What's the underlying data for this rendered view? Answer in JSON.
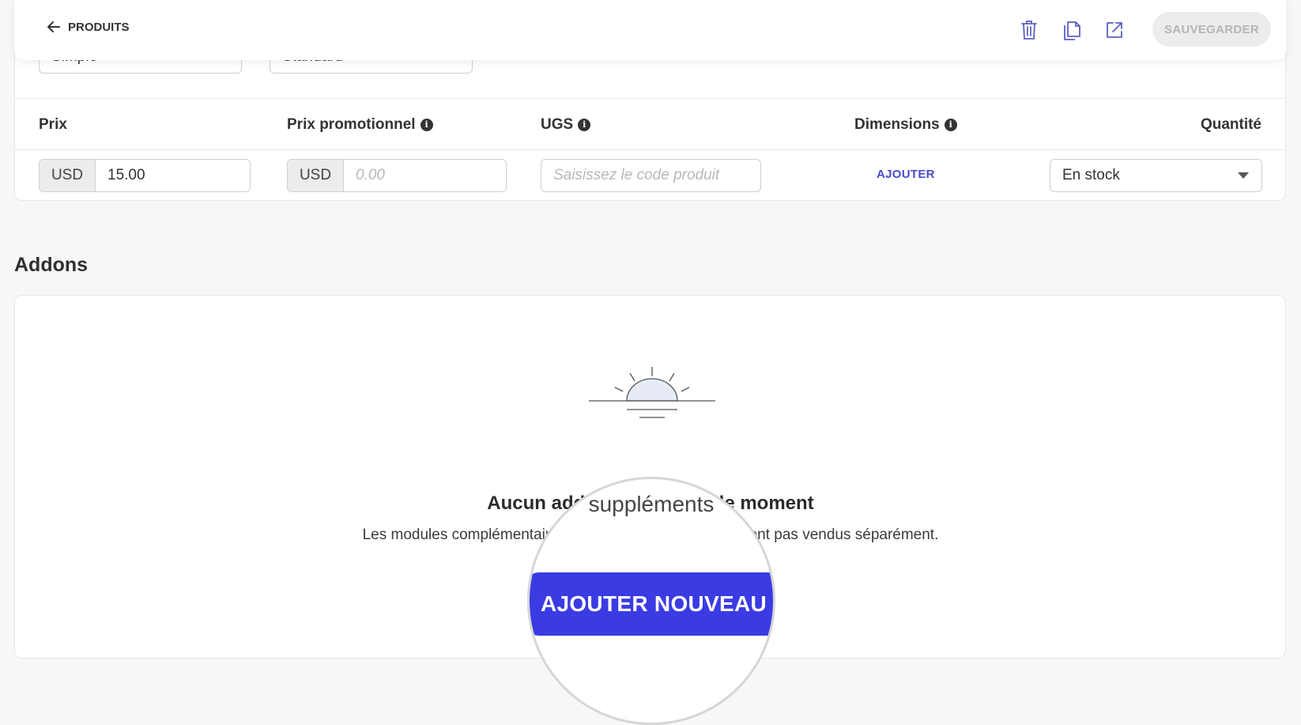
{
  "topbar": {
    "back_label": "PRODUITS",
    "save_label": "SAUVEGARDER",
    "icons": [
      "trash-icon",
      "duplicate-icon",
      "external-link-icon"
    ]
  },
  "variant": {
    "type_select": "Simple",
    "style_select": "Standard",
    "columns": {
      "price": "Prix",
      "promo_price": "Prix promotionnel",
      "sku": "UGS",
      "dimensions": "Dimensions",
      "quantity": "Quantité"
    },
    "price": {
      "currency": "USD",
      "value": "15.00"
    },
    "promo_price": {
      "currency": "USD",
      "placeholder": "0.00"
    },
    "sku": {
      "placeholder": "Saisissez le code produit"
    },
    "dimensions_action": "AJOUTER",
    "quantity_select": "En stock"
  },
  "addons": {
    "title": "Addons",
    "empty_heading": "Aucun add suppléments de moment",
    "empty_desc": "Les modules complémentaires de produit s ont généralement pas vendus séparément.",
    "magnifier_word": "suppléments",
    "add_new_label": "AJOUTER NOUVEAU"
  },
  "colors": {
    "accent": "#3b3be3",
    "link": "#4a4bc9",
    "icon": "#5d5fc0"
  }
}
